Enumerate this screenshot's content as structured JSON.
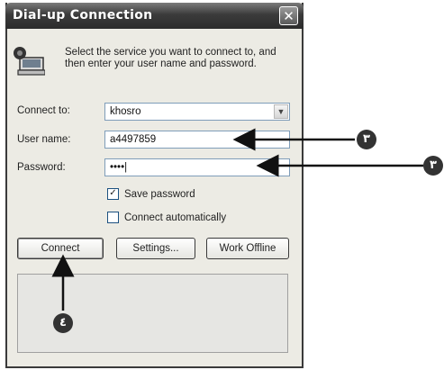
{
  "window": {
    "title": "Dial-up Connection",
    "close_glyph": "✕"
  },
  "intro_text": "Select the service you want to connect to, and then enter your user name and password.",
  "form": {
    "connect_to": {
      "label": "Connect to:",
      "value": "khosro"
    },
    "user_name": {
      "label": "User name:",
      "value": "a4497859"
    },
    "password": {
      "label": "Password:",
      "value": "••••|"
    }
  },
  "options": {
    "save_password": {
      "label": "Save password",
      "checked": true,
      "mark": "✓"
    },
    "connect_automatically": {
      "label": "Connect automatically",
      "checked": false,
      "mark": ""
    }
  },
  "buttons": {
    "connect": "Connect",
    "settings": "Settings...",
    "work_offline": "Work Offline"
  },
  "callouts": {
    "user_name": "٣",
    "password": "٣",
    "connect": "٤"
  },
  "icons": {
    "computer": "computer-phone-icon",
    "dropdown": "chevron-down-icon",
    "close": "close-icon"
  }
}
